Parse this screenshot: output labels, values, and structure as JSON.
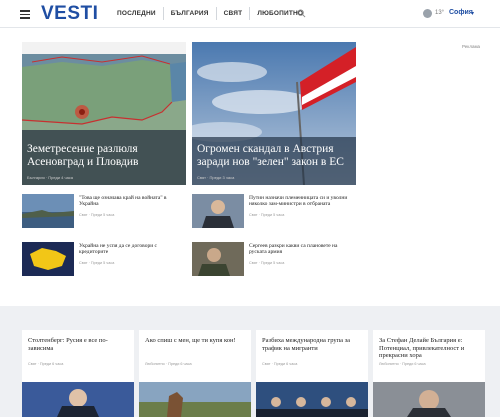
{
  "header": {
    "logo": "VESTI",
    "nav": [
      "ПОСЛЕДНИ",
      "БЪЛГАРИЯ",
      "СВЯТ",
      "ЛЮБОПИТНО"
    ],
    "temperature": "13°",
    "city": "София"
  },
  "ad_label": "Реклама",
  "heroes": [
    {
      "title": "Земетресение разлюля Асеновград и Пловдив",
      "meta": "България · Преди 4 часа"
    },
    {
      "title": "Огромен скандал в Австрия заради нов \"зелен\" закон в ЕС",
      "meta": "Свят · Преди 3 часа"
    }
  ],
  "rows": [
    {
      "title": "\"Това ще означава край на войната\" в Украйна",
      "meta": "Свят · Преди 5 часа"
    },
    {
      "title": "Путин назначи племенницата си и уволни няколко зам-министри в отбраната",
      "meta": "Свят · Преди 5 часа"
    },
    {
      "title": "Украйна не успя да се договори с кредиторите",
      "meta": "Свят · Преди 5 часа"
    },
    {
      "title": "Сергеев разкри какви са плановете на руската армия",
      "meta": "Свят · Преди 5 часа"
    }
  ],
  "bottom": [
    {
      "title": "Столтенберг: Русия е все по-зависима",
      "meta": "Свят · Преди 6 часа"
    },
    {
      "title": "Ако спиш с мен, ще ти купя кон!",
      "meta": "Любопитно · Преди 6 часа"
    },
    {
      "title": "Разбиха международна група за трафик на мигранти",
      "meta": "Свят · Преди 6 часа"
    },
    {
      "title": "За Стефан Делайе България е: Потенциал, привлекателност и прекрасни хора",
      "meta": "Любопитно · Преди 6 часа"
    }
  ],
  "colors": {
    "brand": "#1f4ea3",
    "flag_red": "#d42027"
  }
}
